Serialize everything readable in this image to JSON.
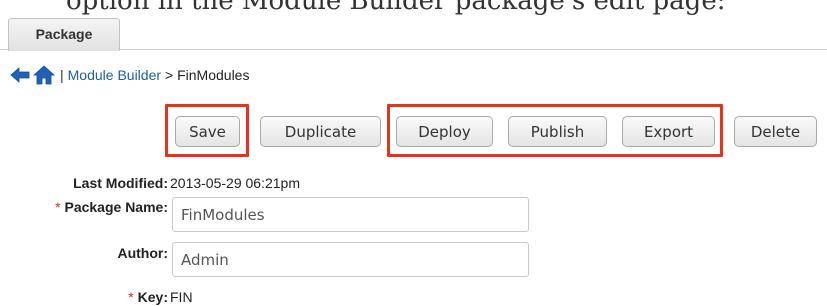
{
  "cropped_caption": "option in the Module Builder package's edit page:",
  "tab": {
    "label": "Package"
  },
  "breadcrumb": {
    "separator": "|",
    "module_builder": "Module Builder",
    "current": "> FinModules"
  },
  "toolbar": {
    "save": "Save",
    "duplicate": "Duplicate",
    "deploy": "Deploy",
    "publish": "Publish",
    "export": "Export",
    "delete": "Delete"
  },
  "form": {
    "last_modified_label": "Last Modified:",
    "last_modified_value": "2013-05-29 06:21pm",
    "package_name_label": "Package Name:",
    "package_name_value": "FinModules",
    "author_label": "Author:",
    "author_value": "Admin",
    "key_label": "Key:",
    "key_value": "FIN",
    "required_marker": "*"
  },
  "colors": {
    "highlight": "#e8331c",
    "link": "#1d5fa8",
    "required": "#d9251d"
  },
  "icons": {
    "back": "back-arrow-icon",
    "home": "home-icon"
  }
}
